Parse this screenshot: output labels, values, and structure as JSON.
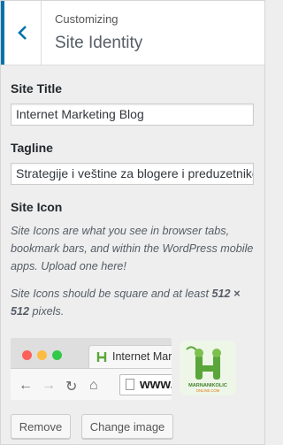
{
  "header": {
    "breadcrumb": "Customizing",
    "title": "Site Identity"
  },
  "site_title": {
    "label": "Site Title",
    "value": "Internet Marketing Blog"
  },
  "tagline": {
    "label": "Tagline",
    "value": "Strategije i veštine za blogere i preduzetnike"
  },
  "site_icon": {
    "label": "Site Icon",
    "desc1": "Site Icons are what you see in browser tabs, bookmark bars, and within the WordPress mobile apps. Upload one here!",
    "desc2_pre": "Site Icons should be square and at least ",
    "desc2_bold": "512 × 512",
    "desc2_post": " pixels."
  },
  "preview": {
    "tab_title": "Internet Mark",
    "url": "www.",
    "logo_text": "MARNANIKOLIC",
    "logo_subtext": "ONLINE.COM"
  },
  "buttons": {
    "remove": "Remove",
    "change": "Change image"
  },
  "colors": {
    "accent": "#0073aa",
    "logo_green": "#5aa63a"
  }
}
